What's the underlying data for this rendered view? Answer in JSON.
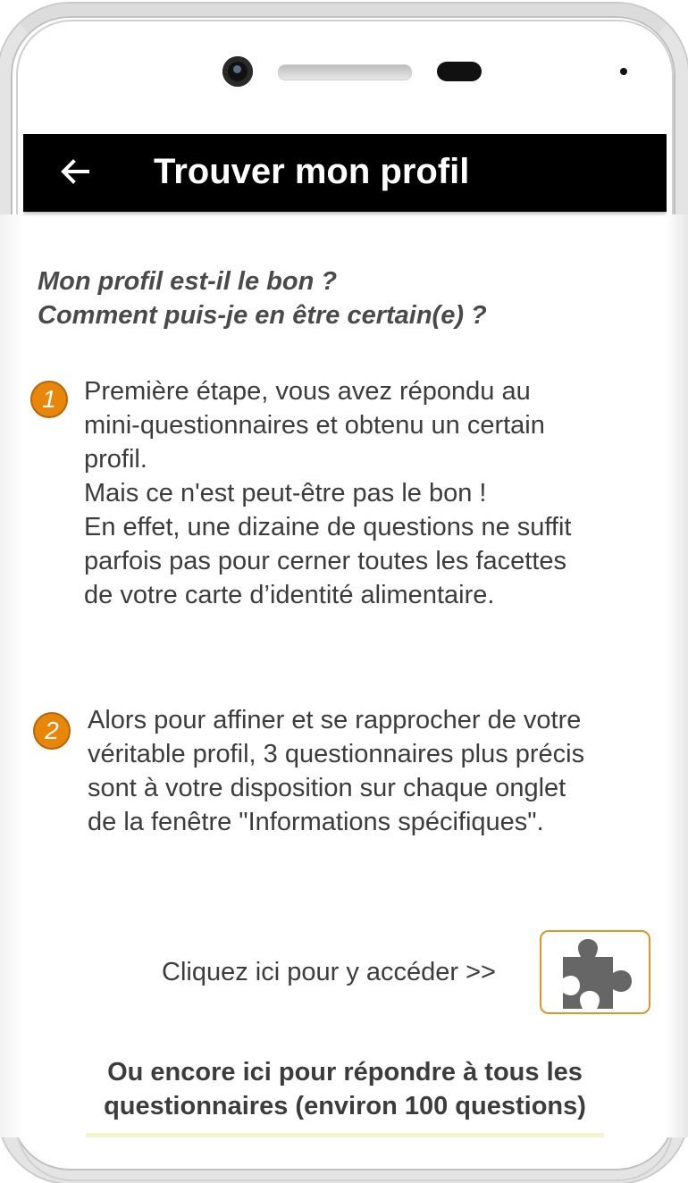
{
  "appbar": {
    "title": "Trouver mon profil",
    "back_icon": "arrow-left-icon"
  },
  "intro": {
    "line1": "Mon profil est-il le bon ?",
    "line2": "Comment puis-je en être certain(e) ?"
  },
  "steps": [
    {
      "number": "1",
      "lines": [
        "Première étape, vous avez répondu au",
        "mini-questionnaires et obtenu un certain",
        "profil.",
        "Mais ce n'est peut-être pas le bon !",
        "En effet, une dizaine de questions ne suffit",
        "parfois pas pour cerner toutes les facettes",
        "de votre carte d’identité alimentaire."
      ]
    },
    {
      "number": "2",
      "lines": [
        "Alors pour affiner et se rapprocher de votre",
        "véritable profil, 3 questionnaires plus précis",
        "sont à votre disposition sur chaque onglet",
        "de la fenêtre  \"Informations spécifiques\"."
      ]
    }
  ],
  "cta": {
    "label": "Cliquez ici pour y accéder >>",
    "icon": "puzzle-piece-icon"
  },
  "bottom": {
    "line1": "Ou encore ici pour répondre à tous les",
    "line2": "questionnaires (environ 100 questions)"
  },
  "colors": {
    "appbar_bg": "#000000",
    "badge": "#e8860a",
    "button_border": "#d9962c",
    "text": "#3c3c3c"
  }
}
